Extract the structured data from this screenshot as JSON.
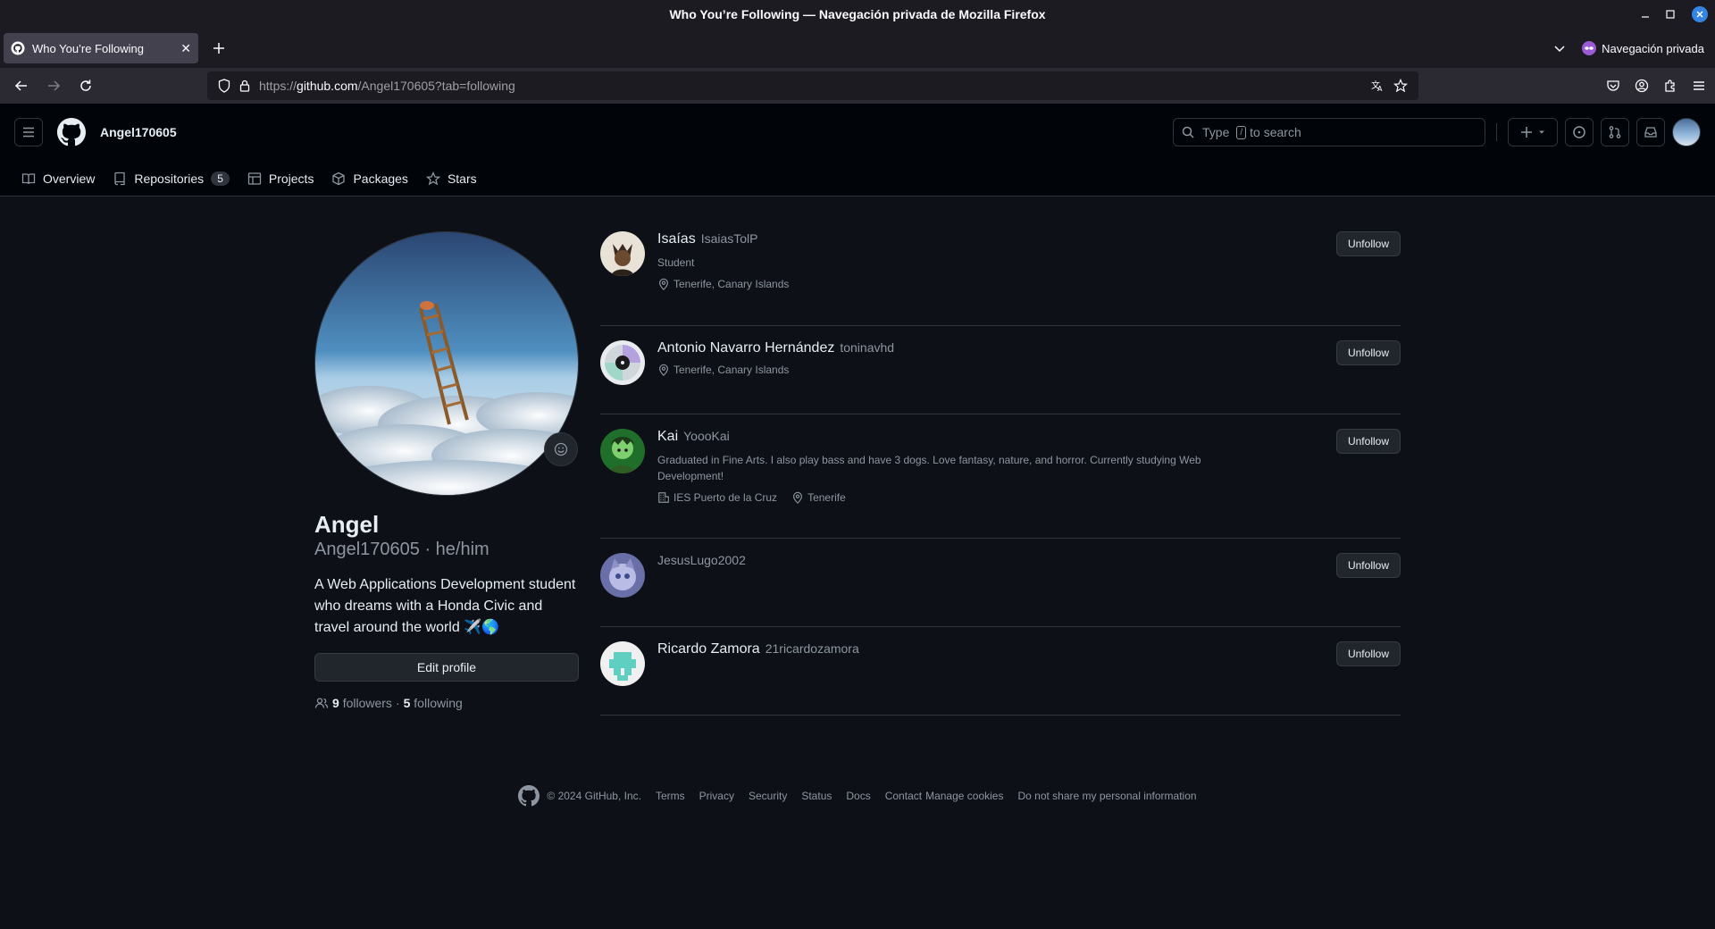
{
  "window": {
    "title": "Who You’re Following — Navegación privada de Mozilla Firefox"
  },
  "tab": {
    "title": "Who You’re Following"
  },
  "private_label": "Navegación privada",
  "url": {
    "prefix": "https://",
    "host": "github.com",
    "path": "/Angel170605?tab=following"
  },
  "header": {
    "username": "Angel170605",
    "search_prefix": "Type",
    "search_key": "/",
    "search_suffix": "to search"
  },
  "nav_tabs": [
    {
      "label": "Overview",
      "icon": "book-icon"
    },
    {
      "label": "Repositories",
      "icon": "repo-icon",
      "count": "5"
    },
    {
      "label": "Projects",
      "icon": "table-icon"
    },
    {
      "label": "Packages",
      "icon": "package-icon"
    },
    {
      "label": "Stars",
      "icon": "star-icon"
    }
  ],
  "profile": {
    "name": "Angel",
    "login_line": "Angel170605 · he/him",
    "bio": "A Web Applications Development student who dreams with a Honda Civic and travel around the world ✈️🌎",
    "edit_label": "Edit profile",
    "followers_count": "9",
    "followers_label": "followers",
    "separator": "·",
    "following_count": "5",
    "following_label": "following"
  },
  "following": [
    {
      "name": "Isaías",
      "login": "IsaiasTolP",
      "bio": "Student",
      "company": "",
      "location": "Tenerife, Canary Islands",
      "button": "Unfollow"
    },
    {
      "name": "Antonio Navarro Hernández",
      "login": "toninavhd",
      "bio": "",
      "company": "",
      "location": "Tenerife, Canary Islands",
      "button": "Unfollow"
    },
    {
      "name": "Kai",
      "login": "YoooKai",
      "bio": "Graduated in Fine Arts. I also play bass and have 3 dogs. Love fantasy, nature, and horror. Currently studying Web Development!",
      "company": "IES Puerto de la Cruz",
      "location": "Tenerife",
      "button": "Unfollow"
    },
    {
      "name": "",
      "login": "JesusLugo2002",
      "bio": "",
      "company": "",
      "location": "",
      "button": "Unfollow"
    },
    {
      "name": "Ricardo Zamora",
      "login": "21ricardozamora",
      "bio": "",
      "company": "",
      "location": "",
      "button": "Unfollow"
    }
  ],
  "footer": {
    "copyright": "© 2024 GitHub, Inc.",
    "links": [
      "Terms",
      "Privacy",
      "Security",
      "Status",
      "Docs",
      "Contact",
      "Manage cookies",
      "Do not share my personal information"
    ]
  }
}
